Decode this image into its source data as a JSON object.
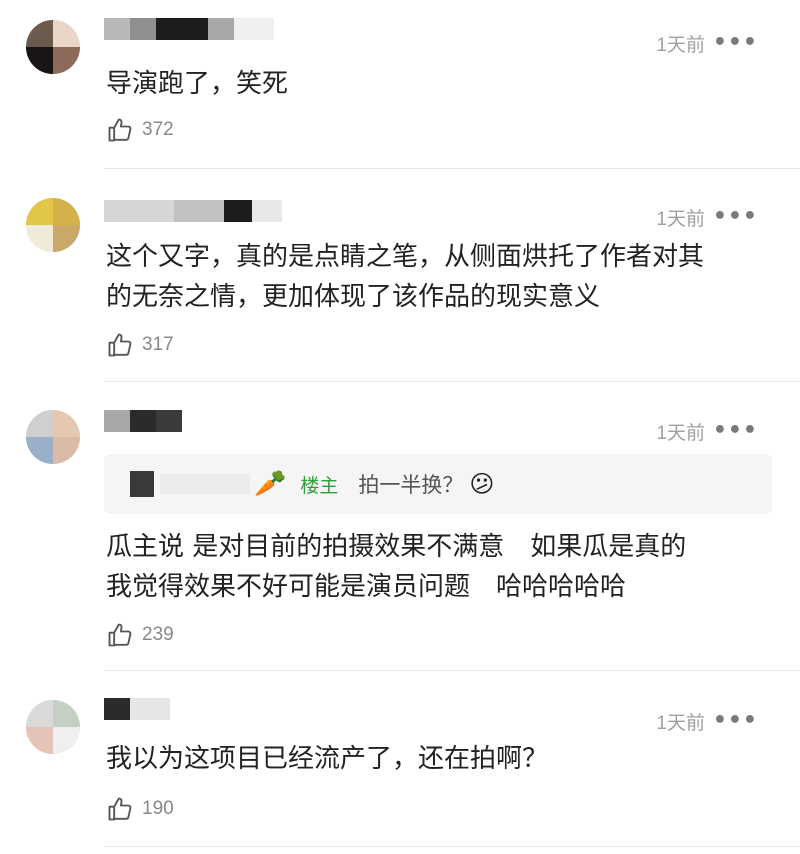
{
  "comments": [
    {
      "time": "1天前",
      "more": "•••",
      "text": "导演跑了，笑死",
      "likes": "372"
    },
    {
      "time": "1天前",
      "more": "•••",
      "text_line1": "这个又字，真的是点睛之笔，从侧面烘托了作者对其",
      "text_line2": "的无奈之情，更加体现了该作品的现实意义",
      "likes": "317"
    },
    {
      "time": "1天前",
      "more": "•••",
      "quote": {
        "icon": "carrot-icon",
        "host_badge": "楼主",
        "text": "拍一半换？",
        "emoji": "confused-face-emoji"
      },
      "text_line1": "瓜主说 是对目前的拍摄效果不满意　如果瓜是真的",
      "text_line2": "我觉得效果不好可能是演员问题　哈哈哈哈哈",
      "likes": "239"
    },
    {
      "time": "1天前",
      "more": "•••",
      "text": "我以为这项目已经流产了，还在拍啊？",
      "likes": "190"
    }
  ],
  "colors": {
    "host_green": "#2f9e3a",
    "muted": "#a0a0a0",
    "text": "#222222"
  }
}
